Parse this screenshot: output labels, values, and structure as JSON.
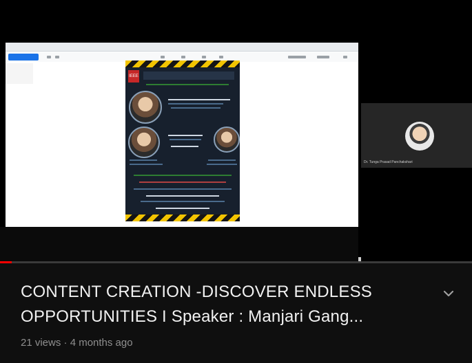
{
  "video": {
    "progress_fraction": 0.025,
    "participant_name": "Dr. Tunga Prasad Panchakshari"
  },
  "poster": {
    "logo_text": "IEEE"
  },
  "details": {
    "title": "CONTENT CREATION -DISCOVER ENDLESS OPPORTUNITIES I Speaker : Manjari Gang...",
    "meta": "21 views · 4 months ago",
    "expand_icon": "chevron-down-icon"
  },
  "colors": {
    "progress": "#ff0000",
    "background": "#0f0f0f"
  }
}
